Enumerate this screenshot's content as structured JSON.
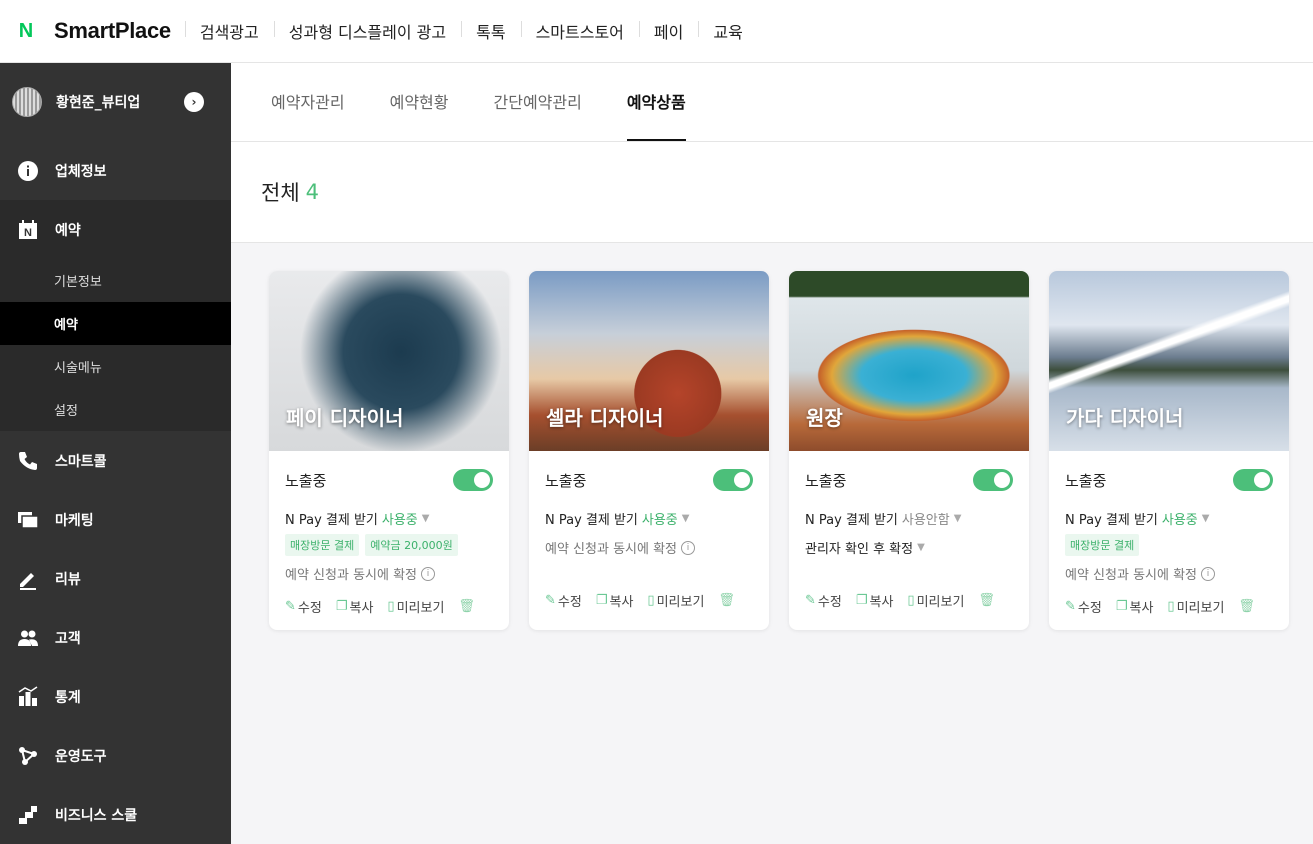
{
  "topnav": {
    "logo_mark": "N",
    "logo_text": "SmartPlace",
    "items": [
      "검색광고",
      "성과형 디스플레이 광고",
      "톡톡",
      "스마트스토어",
      "페이",
      "교육"
    ]
  },
  "sidebar": {
    "profile_name": "황현준_뷰티업",
    "menu": [
      {
        "label": "업체정보",
        "icon": "info-icon"
      },
      {
        "label": "예약",
        "icon": "naver-booking-icon"
      },
      {
        "label": "스마트콜",
        "icon": "phone-icon"
      },
      {
        "label": "마케팅",
        "icon": "marketing-icon"
      },
      {
        "label": "리뷰",
        "icon": "pencil-icon"
      },
      {
        "label": "고객",
        "icon": "people-icon"
      },
      {
        "label": "통계",
        "icon": "stats-icon"
      },
      {
        "label": "운영도구",
        "icon": "tools-icon"
      },
      {
        "label": "비즈니스 스쿨",
        "icon": "stairs-icon"
      }
    ],
    "submenu": [
      "기본정보",
      "예약",
      "시술메뉴",
      "설정"
    ]
  },
  "tabs": [
    "예약자관리",
    "예약현황",
    "간단예약관리",
    "예약상품"
  ],
  "summary": {
    "label": "전체",
    "count": "4"
  },
  "common": {
    "status_label": "노출중",
    "pay_label": "N Pay 결제 받기",
    "edit": "수정",
    "copy": "복사",
    "preview": "미리보기"
  },
  "cards": [
    {
      "title": "페이 디자이너",
      "pay_status": "사용중",
      "badges": [
        "매장방문 결제",
        "예약금 20,000원"
      ],
      "confirm": "예약 신청과 동시에 확정"
    },
    {
      "title": "셀라 디자이너",
      "pay_status": "사용중",
      "badges": [],
      "confirm": "예약 신청과 동시에 확정"
    },
    {
      "title": "원장",
      "pay_status": "사용안함",
      "badges": [],
      "confirm": "관리자 확인 후 확정"
    },
    {
      "title": "가다 디자이너",
      "pay_status": "사용중",
      "badges": [
        "매장방문 결제"
      ],
      "confirm": "예약 신청과 동시에 확정"
    }
  ],
  "colors": {
    "accent": "#4cbf7a",
    "sidebar_bg": "#333333",
    "naver_green": "#03c75a"
  }
}
